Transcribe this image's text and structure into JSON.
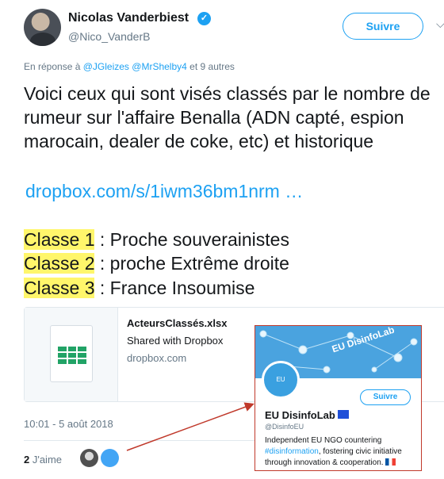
{
  "tweet": {
    "author_name": "Nicolas Vanderbiest",
    "verified_mark": "✓",
    "author_handle": "@Nico_VanderB",
    "follow_label": "Suivre",
    "menu_caret": "⌵",
    "reply_prefix": "En réponse à",
    "reply_mention_1": "@JGleizes",
    "reply_mention_2": "@MrShelby4",
    "reply_suffix": "et 9 autres",
    "text": "Voici ceux qui sont visés classés par le nombre de rumeur sur l'affaire Benalla  (ADN capté, espion marocain, dealer de coke, etc) et historique",
    "link": "dropbox.com/s/1iwm36bm1nrm …",
    "classes": [
      {
        "label": "Classe 1",
        "description": " : Proche souverainistes"
      },
      {
        "label": "Classe 2",
        "description": " : proche Extrême droite"
      },
      {
        "label": "Classe 3",
        "description": " : France Insoumise"
      }
    ],
    "timestamp": "10:01 - 5 août 2018",
    "likes_count": "2",
    "likes_label": " J'aime"
  },
  "card": {
    "title": "ActeursClassés.xlsx",
    "subtitle": "Shared with Dropbox",
    "domain": "dropbox.com",
    "thumb_color": "#21a366"
  },
  "overlay_profile": {
    "banner_text": "EU DisinfoLab",
    "avatar_text": "EU DisinfoLab",
    "follow_label": "Suivre",
    "name": "EU DisinfoLab",
    "handle": "@DisinfoEU",
    "bio_part1": "Independent EU NGO countering ",
    "bio_hashtag": "#disinformation",
    "bio_part2": ", fostering civic initiative through innovation & cooperation. ",
    "border_color": "#c0392b"
  },
  "colors": {
    "accent": "#1da1f2",
    "highlight": "#fff66b",
    "muted": "#657786"
  }
}
